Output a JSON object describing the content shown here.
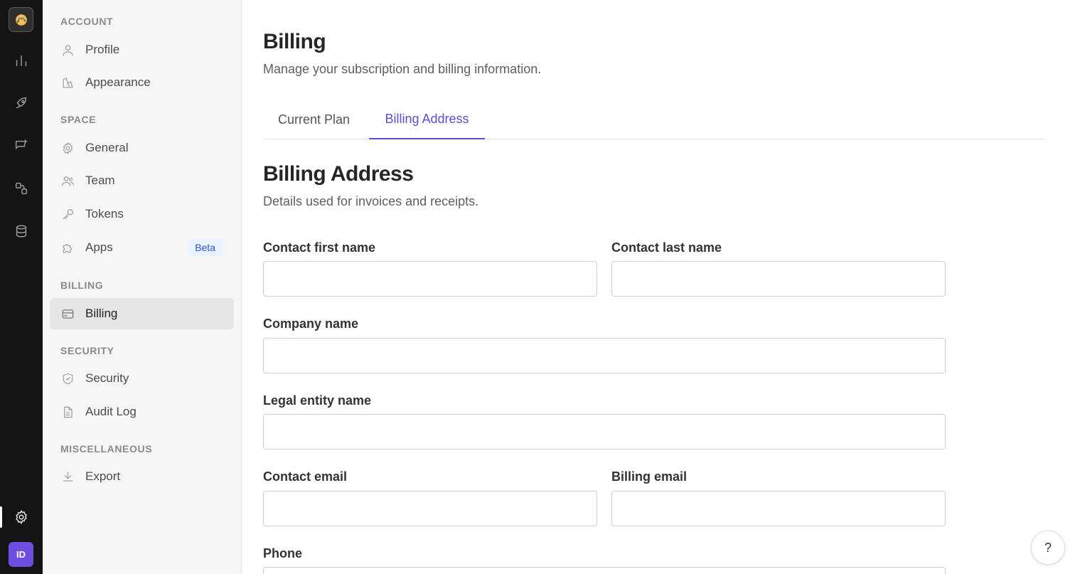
{
  "rail": {
    "items": [
      "analytics-icon",
      "rocket-icon",
      "feedback-icon",
      "integrations-icon",
      "database-icon"
    ],
    "settings_icon": "gear-icon",
    "avatar_initials": "ID"
  },
  "sidebar": {
    "sections": [
      {
        "title": "ACCOUNT",
        "items": [
          {
            "label": "Profile",
            "icon": "user-icon"
          },
          {
            "label": "Appearance",
            "icon": "appearance-icon"
          }
        ]
      },
      {
        "title": "SPACE",
        "items": [
          {
            "label": "General",
            "icon": "gear-icon"
          },
          {
            "label": "Team",
            "icon": "team-icon"
          },
          {
            "label": "Tokens",
            "icon": "key-icon"
          },
          {
            "label": "Apps",
            "icon": "puzzle-icon",
            "badge": "Beta"
          }
        ]
      },
      {
        "title": "BILLING",
        "items": [
          {
            "label": "Billing",
            "icon": "credit-card-icon",
            "selected": true
          }
        ]
      },
      {
        "title": "SECURITY",
        "items": [
          {
            "label": "Security",
            "icon": "shield-icon"
          },
          {
            "label": "Audit Log",
            "icon": "document-icon"
          }
        ]
      },
      {
        "title": "MISCELLANEOUS",
        "items": [
          {
            "label": "Export",
            "icon": "download-icon"
          }
        ]
      }
    ]
  },
  "main": {
    "title": "Billing",
    "subtitle": "Manage your subscription and billing information.",
    "tabs": [
      {
        "label": "Current Plan",
        "active": false
      },
      {
        "label": "Billing Address",
        "active": true
      }
    ],
    "section_title": "Billing Address",
    "section_subtitle": "Details used for invoices and receipts.",
    "fields": {
      "first_name": {
        "label": "Contact first name",
        "value": ""
      },
      "last_name": {
        "label": "Contact last name",
        "value": ""
      },
      "company": {
        "label": "Company name",
        "value": ""
      },
      "legal_entity": {
        "label": "Legal entity name",
        "value": ""
      },
      "contact_email": {
        "label": "Contact email",
        "value": ""
      },
      "billing_email": {
        "label": "Billing email",
        "value": ""
      },
      "phone": {
        "label": "Phone",
        "value": ""
      }
    }
  },
  "help": {
    "label": "?"
  },
  "colors": {
    "accent": "#5b4fd6",
    "rail_bg": "#141414",
    "sidebar_bg": "#f6f6f6",
    "avatar": "#6d4ee0"
  }
}
